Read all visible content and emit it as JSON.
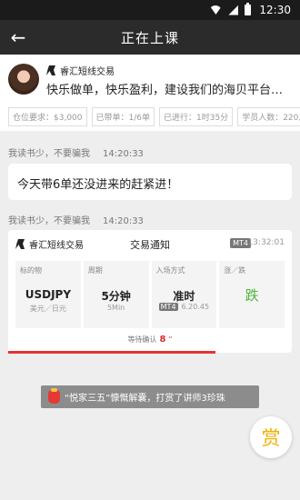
{
  "status": {
    "time": "12:30"
  },
  "header": {
    "title": "正在上课"
  },
  "teacher": {
    "name": "睿汇短线交易",
    "slogan": "快乐做单，快乐盈利，建设我们的海贝平台我…",
    "tags": [
      "仓位要求：$3,000",
      "已带单：1/6单",
      "已进行：1时35分",
      "学员人数：220人"
    ]
  },
  "messages": [
    {
      "sender": "我读书少，不要骗我",
      "time": "14:20:33",
      "text": "今天带6单还没进来的赶紧进！"
    },
    {
      "sender": "我读书少，不要骗我",
      "time": "14:20:33"
    }
  ],
  "trade": {
    "brand": "睿汇短线交易",
    "title": "交易通知",
    "badge": "MT4",
    "timestamp": "13:32:01",
    "cells": [
      {
        "label": "标的物",
        "value": "USDJPY",
        "sub": "美元／日元"
      },
      {
        "label": "周期",
        "value": "5分钟",
        "sub": "5Min"
      },
      {
        "label": "入场方式",
        "value": "准时",
        "chip": "MT4",
        "sub": "6.20.45"
      },
      {
        "label": "涨／跌",
        "value": "跌"
      }
    ],
    "wait_label": "等待确认",
    "wait_count": "8",
    "wait_mark": "“"
  },
  "reward_text": "“悦家三五”慷慨解囊，打赏了讲师3珍珠",
  "tip_label": "赏",
  "colors": {
    "accent_red": "#e63232",
    "down_green": "#4fb43c",
    "tip_gold": "#f0b000"
  }
}
